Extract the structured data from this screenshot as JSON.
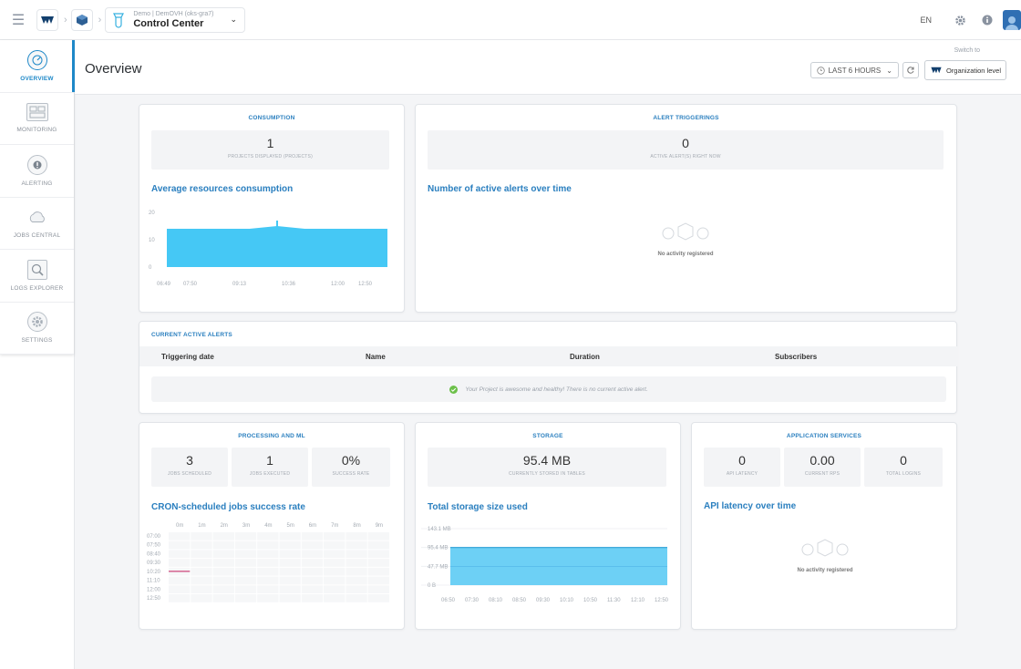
{
  "topbar": {
    "project_org": "Demo | DemOVH (oks-gra7)",
    "project_name": "Control Center",
    "lang": "EN"
  },
  "sidebar": {
    "items": [
      {
        "label": "OVERVIEW",
        "icon": "gauge-icon"
      },
      {
        "label": "MONITORING",
        "icon": "dashboard-icon"
      },
      {
        "label": "ALERTING",
        "icon": "alert-icon"
      },
      {
        "label": "JOBS CENTRAL",
        "icon": "cloud-icon"
      },
      {
        "label": "LOGS EXPLORER",
        "icon": "logs-icon"
      },
      {
        "label": "SETTINGS",
        "icon": "gear-icon"
      }
    ]
  },
  "header": {
    "title": "Overview",
    "switch_to": "Switch to",
    "time_range": "LAST 6 HOURS",
    "org_level": "Organization level"
  },
  "consumption": {
    "title": "CONSUMPTION",
    "value": "1",
    "label": "PROJECTS DISPLAYED (PROJECTS)",
    "chart_title": "Average resources consumption"
  },
  "alerts": {
    "title": "ALERT TRIGGERINGS",
    "value": "0",
    "label": "ACTIVE ALERT(S) RIGHT NOW",
    "chart_title": "Number of active alerts over time",
    "empty": "No activity registered"
  },
  "active_alerts": {
    "title": "CURRENT ACTIVE ALERTS",
    "columns": [
      "Triggering date",
      "Name",
      "Duration",
      "Subscribers"
    ],
    "healthy": "Your Project is awesome and healthy! There is no current active alert."
  },
  "processing": {
    "title": "PROCESSING AND ML",
    "stats": [
      {
        "value": "3",
        "label": "JOBS SCHEDULED"
      },
      {
        "value": "1",
        "label": "JOBS EXECUTED"
      },
      {
        "value": "0%",
        "label": "SUCCESS RATE"
      }
    ],
    "chart_title": "CRON-scheduled jobs success rate",
    "cols": [
      "0m",
      "1m",
      "2m",
      "3m",
      "4m",
      "5m",
      "6m",
      "7m",
      "8m",
      "9m"
    ],
    "rows": [
      "07:00",
      "07:50",
      "08:40",
      "09:30",
      "10:20",
      "11:10",
      "12:00",
      "12:50"
    ]
  },
  "storage": {
    "title": "STORAGE",
    "value": "95.4 MB",
    "label": "CURRENTLY STORED IN TABLES",
    "chart_title": "Total storage size used"
  },
  "app_services": {
    "title": "APPLICATION SERVICES",
    "stats": [
      {
        "value": "0",
        "label": "API LATENCY"
      },
      {
        "value": "0.00",
        "label": "CURRENT RPS"
      },
      {
        "value": "0",
        "label": "TOTAL LOGINS"
      }
    ],
    "chart_title": "API latency over time",
    "empty": "No activity registered"
  },
  "chart_data": [
    {
      "type": "area",
      "title": "Average resources consumption",
      "x": [
        "06:49",
        "07:50",
        "09:13",
        "10:36",
        "12:00",
        "12:50"
      ],
      "yticks": [
        "0",
        "10",
        "20"
      ],
      "ylim": [
        0,
        20
      ],
      "series": [
        {
          "values": [
            14,
            14,
            14,
            14,
            15,
            14,
            14,
            14,
            14
          ]
        }
      ],
      "color": "#45c8f5"
    },
    {
      "type": "area",
      "title": "Total storage size used",
      "x": [
        "06:50",
        "07:30",
        "08:10",
        "08:50",
        "09:30",
        "10:10",
        "10:50",
        "11:30",
        "12:10",
        "12:50"
      ],
      "yticks": [
        "0 B",
        "47.7 MB",
        "95.4 MB",
        "143.1 MB"
      ],
      "series": [
        {
          "values": [
            95.4,
            95.4,
            95.4,
            95.4,
            95.4,
            95.4,
            95.4,
            95.4,
            95.4,
            95.4
          ]
        }
      ],
      "color": "#6dd0f5"
    },
    {
      "type": "heatmap",
      "title": "CRON-scheduled jobs success rate",
      "x": [
        "0m",
        "1m",
        "2m",
        "3m",
        "4m",
        "5m",
        "6m",
        "7m",
        "8m",
        "9m"
      ],
      "y": [
        "07:00",
        "07:50",
        "08:40",
        "09:30",
        "10:20",
        "11:10",
        "12:00",
        "12:50"
      ],
      "marks": [
        {
          "row": "10:20",
          "col": "0m"
        }
      ]
    }
  ]
}
